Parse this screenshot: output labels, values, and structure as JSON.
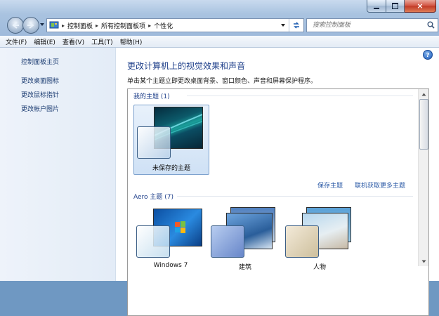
{
  "window": {
    "controls": {
      "minimize": "minimize",
      "maximize": "maximize",
      "close": "×"
    }
  },
  "nav": {
    "breadcrumb": [
      "控制面板",
      "所有控制面板项",
      "个性化"
    ],
    "search_placeholder": "搜索控制面板"
  },
  "menu": [
    "文件(F)",
    "编辑(E)",
    "查看(V)",
    "工具(T)",
    "帮助(H)"
  ],
  "sidebar": {
    "items": [
      "控制面板主页",
      "更改桌面图标",
      "更改鼠标指针",
      "更改帐户图片"
    ]
  },
  "main": {
    "title": "更改计算机上的视觉效果和声音",
    "subtitle": "单击某个主题立即更改桌面背景、窗口颜色、声音和屏幕保护程序。",
    "help_icon": "?",
    "my_themes": {
      "title": "我的主题 (1)",
      "items": [
        {
          "label": "未保存的主题"
        }
      ],
      "links": {
        "save": "保存主题",
        "more": "联机获取更多主题"
      }
    },
    "aero_themes": {
      "title": "Aero 主题 (7)",
      "items": [
        {
          "label": "Windows 7"
        },
        {
          "label": "建筑"
        },
        {
          "label": "人物"
        }
      ]
    }
  },
  "colors": {
    "accent_link": "#2b5aa6",
    "title_blue": "#1e3f8a",
    "selection": "#cfe1f5"
  },
  "icons": [
    "back-arrow-icon",
    "forward-arrow-icon",
    "control-panel-icon",
    "refresh-icon",
    "search-icon",
    "help-icon",
    "minimize-icon",
    "maximize-icon",
    "close-icon"
  ]
}
